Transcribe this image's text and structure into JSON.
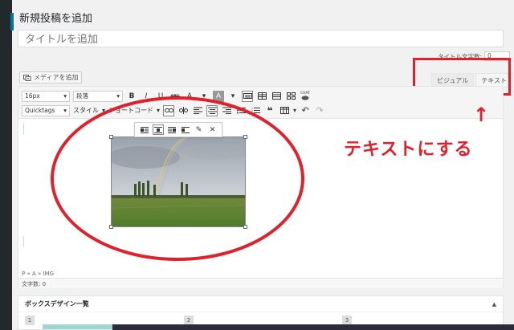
{
  "page": {
    "title": "新規投稿を追加"
  },
  "title_field": {
    "placeholder": "タイトルを追加"
  },
  "char_count": {
    "label": "タイトル文字数:",
    "value": "0"
  },
  "media": {
    "button_label": "メディアを追加",
    "icon": "media-icon"
  },
  "editor_tabs": [
    {
      "label": "ビジュアル",
      "active": false
    },
    {
      "label": "テキスト",
      "active": true
    }
  ],
  "toolbar": {
    "font_size": "16px",
    "paragraph": "段落",
    "quicktags": "Quicktags",
    "style": "スタイル",
    "shortcode": "ショートコード",
    "bold": "B",
    "italic": "I",
    "underline": "U",
    "strike": "ABC",
    "text_color": "A",
    "bg_color": "A",
    "chart": "CHAT"
  },
  "image_toolbar": {
    "icons": [
      "align-left-icon",
      "align-center-icon",
      "align-right-icon",
      "align-none-icon",
      "edit-icon",
      "remove-icon"
    ]
  },
  "status": {
    "path": "P » A » IMG",
    "word_count": "文字数: 0"
  },
  "annotation": {
    "text": "テキストにする",
    "arrow": "↑"
  },
  "meta_box": {
    "title": "ボックスデザイン一覧",
    "toggle": "▲",
    "boxes": [
      "1",
      "2",
      "3"
    ]
  },
  "colors": {
    "annotation_red": "#e0202a",
    "accent_blue": "#0073aa"
  }
}
